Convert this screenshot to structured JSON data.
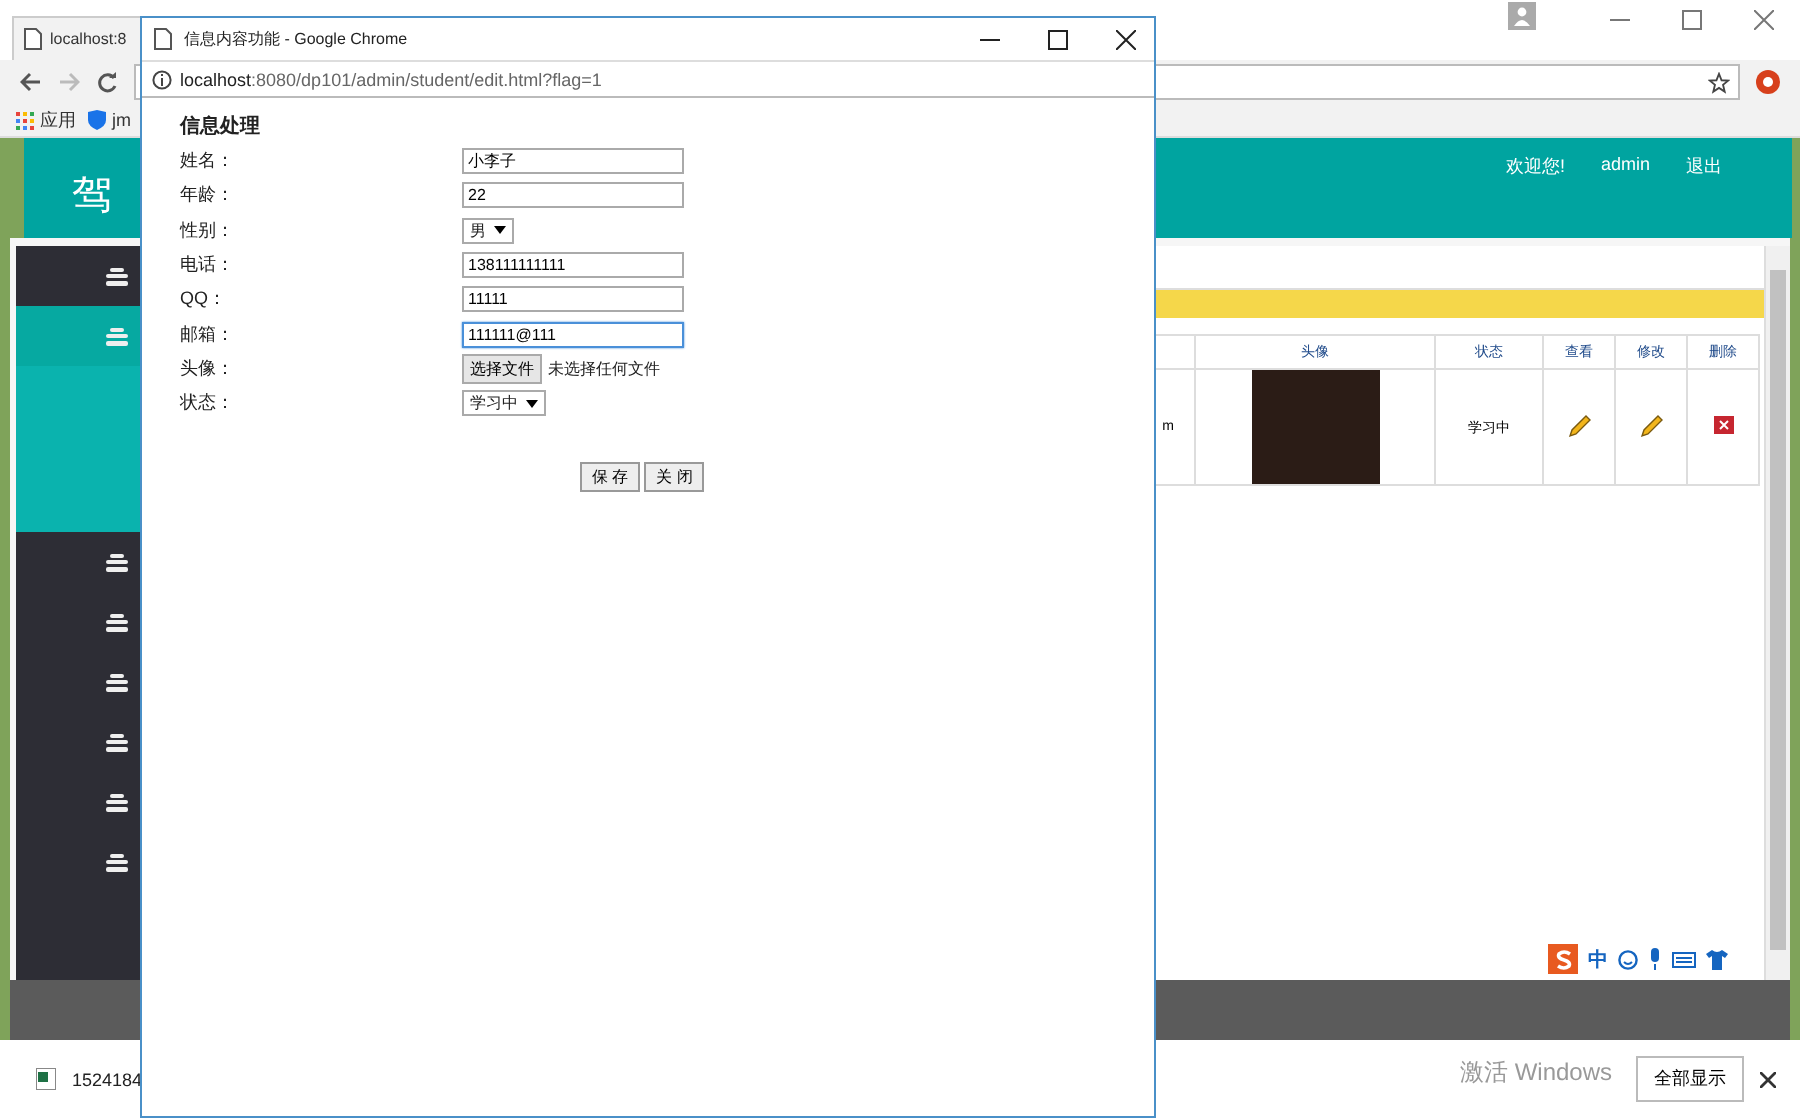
{
  "browser": {
    "tab_title": "localhost:8",
    "bookmarks": [
      "应用",
      "jm"
    ]
  },
  "site": {
    "logo": "驾",
    "welcome": "欢迎您!",
    "user": "admin",
    "logout": "退出"
  },
  "sidebar": {
    "items": [
      {
        "selected": false
      },
      {
        "selected": true
      },
      {
        "selected": false
      },
      {
        "selected": false
      },
      {
        "selected": false
      },
      {
        "selected": false
      },
      {
        "selected": false
      },
      {
        "selected": false
      }
    ]
  },
  "table": {
    "columns": [
      "头像",
      "状态",
      "查看",
      "修改",
      "删除"
    ],
    "rows": [
      {
        "column_1": "m",
        "status": "学习中"
      }
    ]
  },
  "ime": {
    "mode": "中"
  },
  "downloads": {
    "file": "1524184",
    "show_all": "全部显示"
  },
  "activation_notice": "激活 Windows",
  "popup": {
    "title": "信息内容功能 - Google Chrome",
    "url_host": "localhost",
    "url_rest": ":8080/dp101/admin/student/edit.html?flag=1",
    "heading": "信息处理",
    "fields": [
      {
        "label": "姓名：",
        "kind": "text",
        "value": "小李子",
        "focused": false
      },
      {
        "label": "年龄：",
        "kind": "text",
        "value": "22",
        "focused": false
      },
      {
        "label": "性别：",
        "kind": "select",
        "value": "男",
        "focused": false
      },
      {
        "label": "电话：",
        "kind": "text",
        "value": "138111111111",
        "focused": false
      },
      {
        "label": "QQ：",
        "kind": "text",
        "value": "11111",
        "focused": false
      },
      {
        "label": "邮箱：",
        "kind": "text",
        "value": "111111@111",
        "focused": true
      },
      {
        "label": "头像：",
        "kind": "file",
        "button": "选择文件",
        "value": "未选择任何文件",
        "focused": false
      },
      {
        "label": "状态：",
        "kind": "select",
        "value": "学习中",
        "focused": false
      }
    ],
    "buttons": [
      "保 存",
      "关 闭"
    ]
  }
}
